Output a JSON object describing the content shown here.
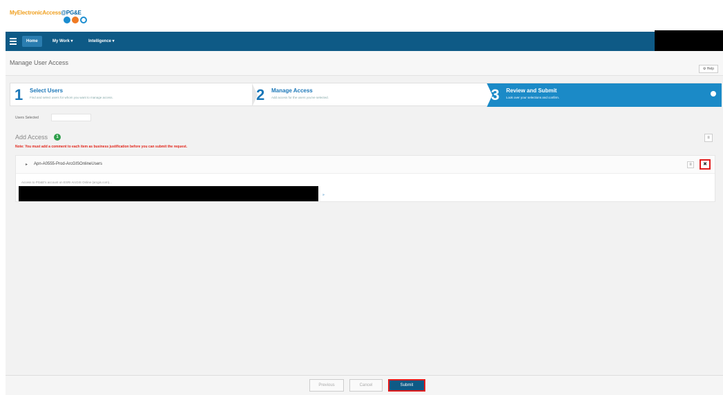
{
  "header": {
    "logo_part1": "MyElectronicAccess",
    "logo_part2": "@PG&E"
  },
  "nav": {
    "items": [
      {
        "label": "Home"
      },
      {
        "label": "My Work ▾"
      },
      {
        "label": "Intelligence ▾"
      }
    ]
  },
  "page": {
    "title": "Manage User Access",
    "help_label": "⚙ Help"
  },
  "steps": [
    {
      "number": "1",
      "title": "Select Users",
      "desc": "Find and select users for whom you want to manage access."
    },
    {
      "number": "2",
      "title": "Manage Access",
      "desc": "Add access for the users you've selected."
    },
    {
      "number": "3",
      "title": "Review and Submit",
      "desc": "Look over your selections and confirm."
    }
  ],
  "users_selected": {
    "label": "Users Selected",
    "value": ""
  },
  "add_access": {
    "title": "Add Access",
    "count": "1",
    "note": "Note: You must add a comment to each item as business justification before you can submit the request.",
    "collapse_icon": "≡",
    "items": [
      {
        "caret": "▸",
        "name": "Apn-A0555-Prod-ArcGISOnlineUsers",
        "comment_icon": "≡",
        "remove_icon": "✖",
        "description": "Access to PG&E's account on ESRI ArcGIS Online (arcgis.com)...",
        "more_link": "»"
      }
    ]
  },
  "footer": {
    "previous_label": "Previous",
    "cancel_label": "Cancel",
    "submit_label": "Submit"
  },
  "colors": {
    "nav_bg": "#0e5a86",
    "step_active": "#1b8ac7",
    "highlight": "#e21b1b",
    "badge": "#2e9e4a"
  }
}
